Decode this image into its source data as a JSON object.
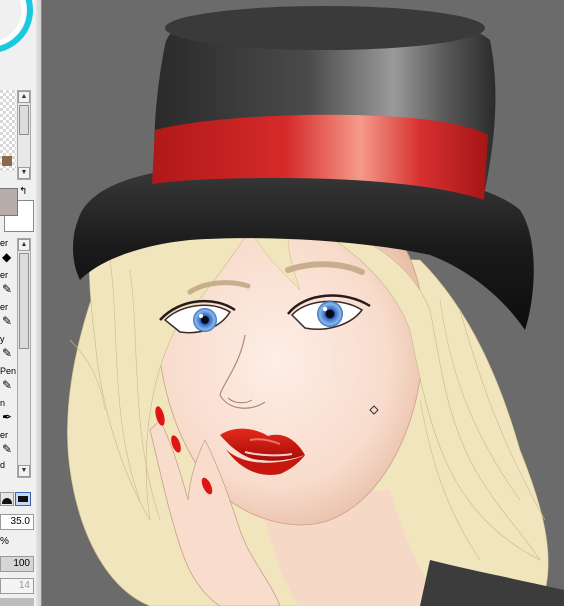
{
  "panel": {
    "tools": [
      {
        "label": "er",
        "icon": "eraser-icon"
      },
      {
        "label": "er",
        "icon": "pen-icon"
      },
      {
        "label": "er",
        "icon": "pencil-icon"
      },
      {
        "label": "y",
        "icon": "brush-icon"
      },
      {
        "label": "Pen",
        "icon": "pen-icon"
      },
      {
        "label": "n",
        "icon": "marker-icon"
      },
      {
        "label": "er",
        "icon": "pencil-icon"
      },
      {
        "label": "d",
        "icon": "pen-icon"
      }
    ],
    "brush_size": "35.0",
    "percent_label": "%",
    "density_value": "100",
    "secondary_value": "14"
  },
  "canvas": {
    "background_color": "#6b6b6b",
    "subject": "woman-in-top-hat-illustration"
  },
  "colors": {
    "hat": "#2a2a2a",
    "hat_band": "#d62a2a",
    "hair": "#f1e5bd",
    "skin": "#fbe4d8",
    "lips": "#d81c12",
    "eyes": "#5a9ae0"
  }
}
